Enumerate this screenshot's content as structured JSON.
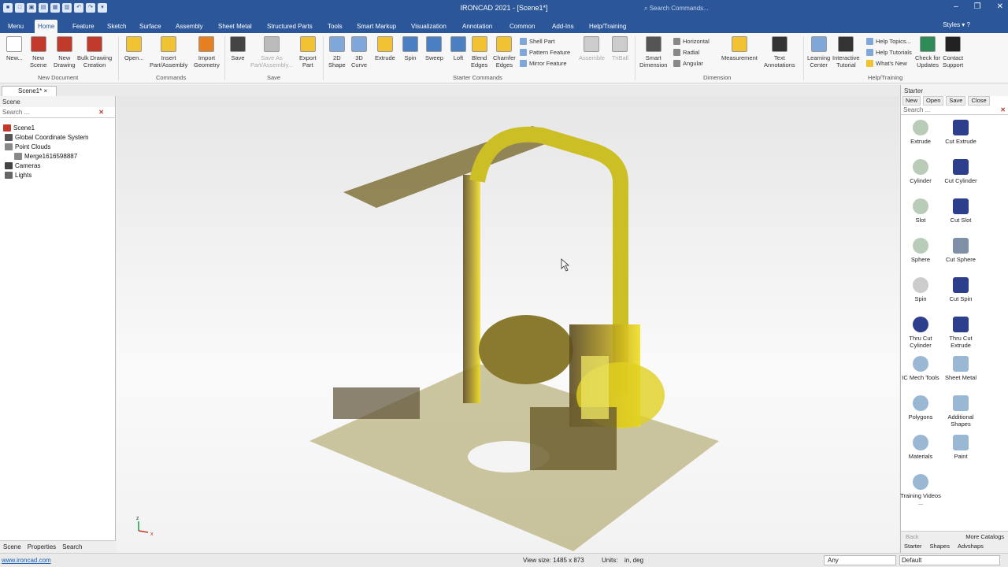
{
  "app": {
    "title": "IRONCAD 2021 - [Scene1*]",
    "search_placeholder": "Search Commands...",
    "styles_label": "Styles",
    "accent": "#2b579a"
  },
  "menu_tabs": [
    "Menu",
    "Home",
    "Feature",
    "Sketch",
    "Surface",
    "Assembly",
    "Sheet Metal",
    "Structured Parts",
    "Tools",
    "Smart Markup",
    "Visualization",
    "Annotation",
    "Common",
    "Add-Ins",
    "Help/Training"
  ],
  "active_tab": "Home",
  "ribbon": {
    "buttons": [
      {
        "l1": "New...",
        "l2": "",
        "c": "#ffffff",
        "dis": false
      },
      {
        "l1": "New",
        "l2": "Scene",
        "c": "#c0392b",
        "dis": false
      },
      {
        "l1": "New",
        "l2": "Drawing",
        "c": "#c0392b",
        "dis": false
      },
      {
        "l1": "Bulk Drawing",
        "l2": "Creation",
        "c": "#c0392b",
        "dis": false
      },
      {
        "l1": "Open...",
        "l2": "",
        "c": "#f1c232",
        "dis": false
      },
      {
        "l1": "Insert",
        "l2": "Part/Assembly",
        "c": "#f1c232",
        "dis": false
      },
      {
        "l1": "Import",
        "l2": "Geometry",
        "c": "#e67e22",
        "dis": false
      },
      {
        "l1": "Save",
        "l2": "",
        "c": "#444444",
        "dis": false
      },
      {
        "l1": "Save As",
        "l2": "Part/Assembly...",
        "c": "#bbbbbb",
        "dis": true
      },
      {
        "l1": "Export",
        "l2": "Part",
        "c": "#f1c232",
        "dis": false
      },
      {
        "l1": "2D",
        "l2": "Shape",
        "c": "#7fa7d9",
        "dis": false
      },
      {
        "l1": "3D",
        "l2": "Curve",
        "c": "#7fa7d9",
        "dis": false
      },
      {
        "l1": "Extrude",
        "l2": "",
        "c": "#f1c232",
        "dis": false
      },
      {
        "l1": "Spin",
        "l2": "",
        "c": "#4a7fc1",
        "dis": false
      },
      {
        "l1": "Sweep",
        "l2": "",
        "c": "#4a7fc1",
        "dis": false
      },
      {
        "l1": "Loft",
        "l2": "",
        "c": "#4a7fc1",
        "dis": false
      },
      {
        "l1": "Blend",
        "l2": "Edges",
        "c": "#f1c232",
        "dis": false
      },
      {
        "l1": "Chamfer",
        "l2": "Edges",
        "c": "#f1c232",
        "dis": false
      },
      {
        "l1": "Assemble",
        "l2": "",
        "c": "#cccccc",
        "dis": true
      },
      {
        "l1": "TriBall",
        "l2": "",
        "c": "#cccccc",
        "dis": true
      },
      {
        "l1": "Smart",
        "l2": "Dimension",
        "c": "#555555",
        "dis": false
      },
      {
        "l1": "Measurement",
        "l2": "",
        "c": "#f1c232",
        "dis": false
      },
      {
        "l1": "Text",
        "l2": "Annotations",
        "c": "#333333",
        "dis": false
      },
      {
        "l1": "Learning",
        "l2": "Center",
        "c": "#7fa7d9",
        "dis": false
      },
      {
        "l1": "Interactive",
        "l2": "Tutorial",
        "c": "#333333",
        "dis": false
      },
      {
        "l1": "Check for",
        "l2": "Updates",
        "c": "#2e8b57",
        "dis": false
      },
      {
        "l1": "Contact",
        "l2": "Support",
        "c": "#222222",
        "dis": false
      }
    ],
    "small_buttons": [
      "Shell Part",
      "Pattern Feature",
      "Mirror Feature",
      "Horizontal",
      "Radial",
      "Angular",
      "Help Topics...",
      "Help Tutorials",
      "What's New"
    ],
    "groups": [
      "New Document",
      "Commands",
      "Save",
      "Starter Commands",
      "Dimension",
      "Help/Training"
    ]
  },
  "doc_tab": "Scene1*",
  "scene_panel": {
    "header": "Scene",
    "search_placeholder": "Search ...",
    "tree": [
      {
        "label": "Scene1",
        "color": "#c0392b"
      },
      {
        "label": "Global Coordinate System",
        "color": "#555555"
      },
      {
        "label": "Point Clouds",
        "color": "#888888"
      },
      {
        "label": "Merge1616598887",
        "color": "#888888"
      },
      {
        "label": "Cameras",
        "color": "#444444"
      },
      {
        "label": "Lights",
        "color": "#666666"
      }
    ],
    "bottom_tabs": [
      "Scene",
      "Properties",
      "Search"
    ]
  },
  "catalog": {
    "header": "Starter",
    "actions": [
      "New",
      "Open",
      "Save",
      "Close"
    ],
    "search_placeholder": "Search ...",
    "items": [
      {
        "label": "Extrude",
        "color": "#b8ccb8"
      },
      {
        "label": "Cut Extrude",
        "color": "#2c3e8c"
      },
      {
        "label": "Cylinder",
        "color": "#b8ccb8"
      },
      {
        "label": "Cut Cylinder",
        "color": "#2c3e8c"
      },
      {
        "label": "Slot",
        "color": "#b8ccb8"
      },
      {
        "label": "Cut Slot",
        "color": "#2c3e8c"
      },
      {
        "label": "Sphere",
        "color": "#b8ccb8"
      },
      {
        "label": "Cut Sphere",
        "color": "#7f8fa6"
      },
      {
        "label": "Spin",
        "color": "#cccccc"
      },
      {
        "label": "Cut Spin",
        "color": "#2c3e8c"
      },
      {
        "label": "Thru Cut Cylinder",
        "color": "#2c3e8c"
      },
      {
        "label": "Thru Cut Extrude",
        "color": "#2c3e8c"
      },
      {
        "label": "IC Mech Tools",
        "color": "#9ab8d4"
      },
      {
        "label": "Sheet Metal",
        "color": "#9ab8d4"
      },
      {
        "label": "Polygons",
        "color": "#9ab8d4"
      },
      {
        "label": "Additional Shapes",
        "color": "#9ab8d4"
      },
      {
        "label": "Materials",
        "color": "#9ab8d4"
      },
      {
        "label": "Paint",
        "color": "#9ab8d4"
      },
      {
        "label": "Training Videos ...",
        "color": "#9ab8d4"
      }
    ],
    "back_label": "Back",
    "more_label": "More Catalogs",
    "bottom_tabs": [
      "Starter",
      "Shapes",
      "Advshaps"
    ]
  },
  "status": {
    "link": "www.ironcad.com",
    "view_size": "View size: 1485 x 873",
    "units_label": "Units:",
    "units_value": "in, deg",
    "filter": "Any",
    "style": "Default"
  },
  "axis": {
    "z": "z",
    "x": "x"
  }
}
